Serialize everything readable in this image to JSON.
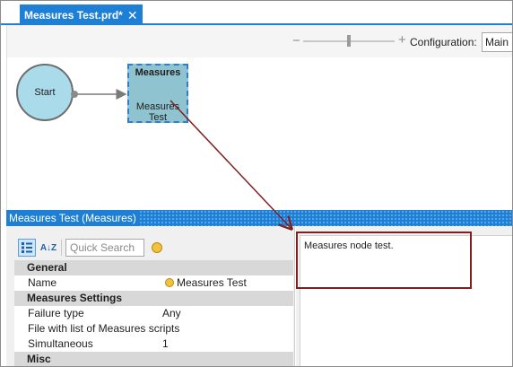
{
  "tab": {
    "title": "Measures Test.prd*",
    "close_icon": "close-icon",
    "close_glyph": "✕"
  },
  "toolbar": {
    "zoom_out_glyph": "−",
    "zoom_in_glyph": "+",
    "configuration_label": "Configuration:",
    "configuration_value": "Main"
  },
  "diagram": {
    "start_node": {
      "label": "Start"
    },
    "measures_node": {
      "title": "Measures",
      "label": "Measures Test"
    },
    "connector_icon": "arrow-icon"
  },
  "properties_panel": {
    "title": "Measures Test (Measures)",
    "categorized_icon": "categorized-icon",
    "sort_icon": "sort-az-icon",
    "sort_glyph": "A↓Z",
    "search_placeholder": "Quick Search",
    "property_pages_icon": "property-pages-icon",
    "rows": [
      {
        "type": "category",
        "label": "General"
      },
      {
        "type": "property",
        "name": "Name",
        "value": "Measures Test",
        "icon": "property-icon"
      },
      {
        "type": "category",
        "label": "Measures Settings"
      },
      {
        "type": "property",
        "name": "Failure type",
        "value": "Any"
      },
      {
        "type": "property",
        "name": "File with list of Measures scripts",
        "value": ""
      },
      {
        "type": "property",
        "name": "Simultaneous",
        "value": "1"
      },
      {
        "type": "category",
        "label": "Misc"
      }
    ]
  },
  "description": {
    "text": "Measures node test."
  },
  "colors": {
    "tab_active": "#1e7fd6",
    "start_node_fill": "#a9dbea",
    "measures_node_fill": "#8fc3cf",
    "selection_border": "#2f7fd0",
    "annotation": "#7f1f1f"
  }
}
